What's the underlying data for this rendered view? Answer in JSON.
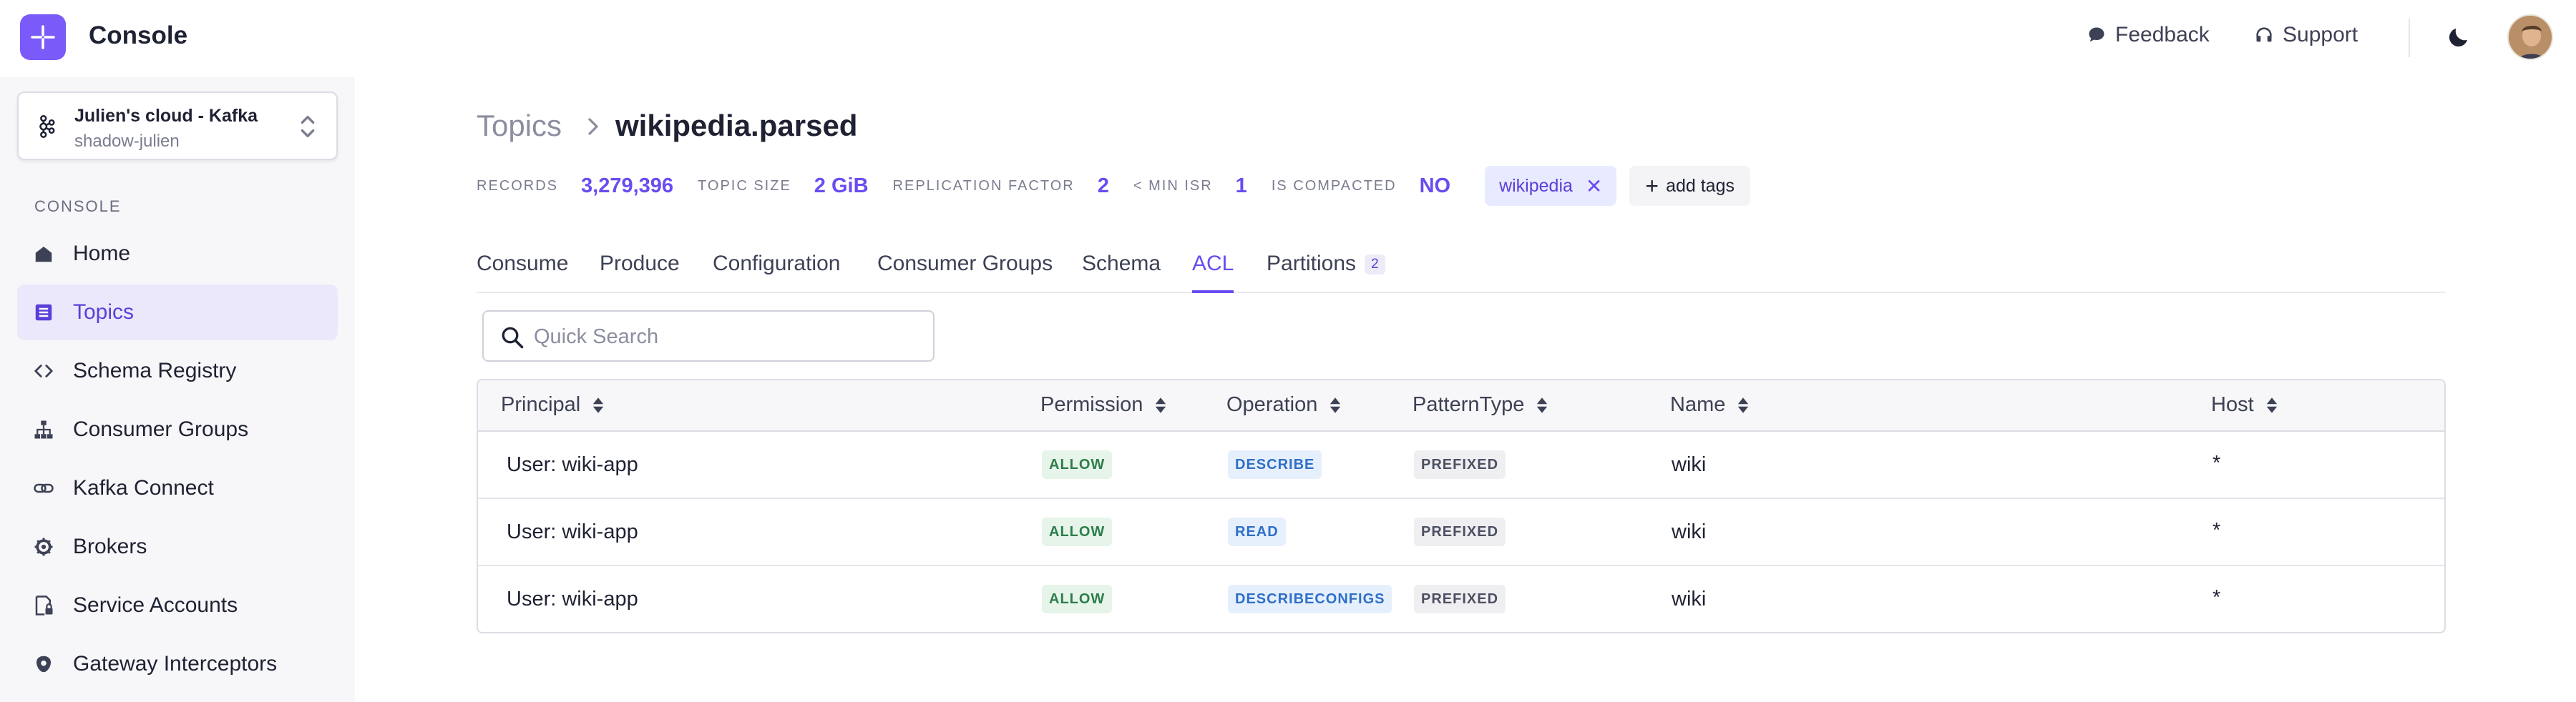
{
  "header": {
    "app_name": "Console",
    "feedback_label": "Feedback",
    "support_label": "Support"
  },
  "sidebar": {
    "cluster_name": "Julien's cloud - Kafka",
    "cluster_sub": "shadow-julien",
    "section_label": "CONSOLE",
    "items": [
      {
        "label": "Home",
        "icon": "home-icon"
      },
      {
        "label": "Topics",
        "icon": "topics-icon",
        "active": true
      },
      {
        "label": "Schema Registry",
        "icon": "code-icon"
      },
      {
        "label": "Consumer Groups",
        "icon": "hierarchy-icon"
      },
      {
        "label": "Kafka Connect",
        "icon": "link-icon"
      },
      {
        "label": "Brokers",
        "icon": "cog-icon"
      },
      {
        "label": "Service Accounts",
        "icon": "account-lock-icon"
      },
      {
        "label": "Gateway Interceptors",
        "icon": "gateway-icon"
      }
    ]
  },
  "breadcrumb": {
    "root": "Topics",
    "current": "wikipedia.parsed"
  },
  "stats": {
    "records_label": "RECORDS",
    "records_value": "3,279,396",
    "size_label": "TOPIC SIZE",
    "size_value": "2 GiB",
    "replication_label": "REPLICATION FACTOR",
    "replication_value": "2",
    "min_isr_label": "< MIN ISR",
    "min_isr_value": "1",
    "compacted_label": "IS COMPACTED",
    "compacted_value": "NO",
    "tag": "wikipedia",
    "add_tags_label": "add tags"
  },
  "tabs": [
    {
      "label": "Consume"
    },
    {
      "label": "Produce"
    },
    {
      "label": "Configuration"
    },
    {
      "label": "Consumer Groups"
    },
    {
      "label": "Schema"
    },
    {
      "label": "ACL",
      "active": true
    },
    {
      "label": "Partitions",
      "count": "2"
    }
  ],
  "search": {
    "placeholder": "Quick Search"
  },
  "table": {
    "columns": [
      "Principal",
      "Permission",
      "Operation",
      "PatternType",
      "Name",
      "Host"
    ],
    "rows": [
      {
        "principal": "User: wiki-app",
        "permission": "ALLOW",
        "operation": "DESCRIBE",
        "pattern": "PREFIXED",
        "name": "wiki",
        "host": "*"
      },
      {
        "principal": "User: wiki-app",
        "permission": "ALLOW",
        "operation": "READ",
        "pattern": "PREFIXED",
        "name": "wiki",
        "host": "*"
      },
      {
        "principal": "User: wiki-app",
        "permission": "ALLOW",
        "operation": "DESCRIBECONFIGS",
        "pattern": "PREFIXED",
        "name": "wiki",
        "host": "*"
      }
    ]
  },
  "colors": {
    "accent": "#6a4cf0",
    "brand": "#7a5af8",
    "allow": "#2e7d4a",
    "operation": "#2f6fc8"
  }
}
